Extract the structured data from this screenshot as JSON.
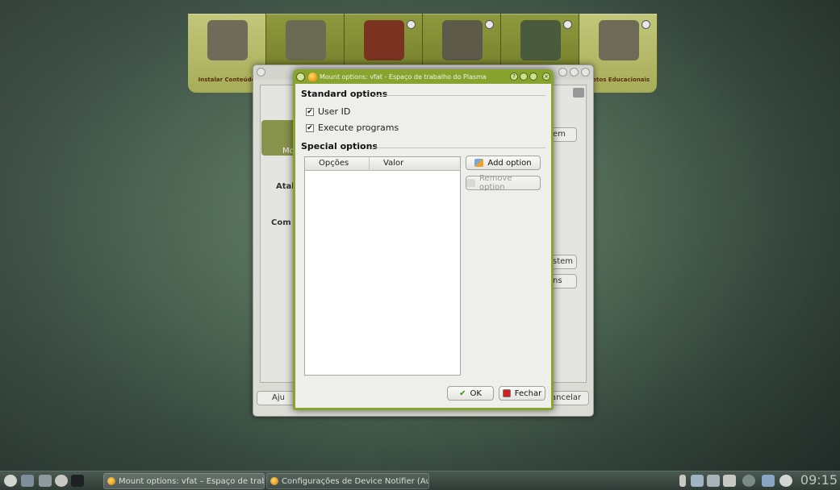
{
  "launcher": {
    "tiles": [
      {
        "label": "Instalar Conteúdo",
        "art_color": "#6f6b58"
      },
      {
        "label": "",
        "art_color": "#6b6a52"
      },
      {
        "label": "",
        "art_color": "#7a3320"
      },
      {
        "label": "",
        "art_color": "#5d5a4a"
      },
      {
        "label": "",
        "art_color": "#4a5a3c"
      },
      {
        "label": "bjetos Educacionais",
        "art_color": "#6d6a58"
      }
    ]
  },
  "background_window": {
    "tab_label": "Mo",
    "label_atal": "Atal",
    "label_comp": "Com",
    "btn_top": "em",
    "btn_mid1": "stem",
    "btn_mid2": "ns",
    "btn_help": "Aju",
    "btn_cancel": "ancelar"
  },
  "dialog": {
    "title": "Mount options: vfat - Espaço de trabalho do Plasma",
    "standard_group": "Standard options",
    "special_group": "Special options",
    "options": [
      {
        "label": "User ID",
        "checked": true
      },
      {
        "label": "Execute programs",
        "checked": true
      }
    ],
    "table": {
      "col1": "Opções",
      "col2": "Valor"
    },
    "add_option": "Add option",
    "remove_option": "Remove option",
    "ok": "OK",
    "close": "Fechar"
  },
  "taskbar": {
    "tasks": [
      {
        "label": "Mount options: vfat – Espaço de traba"
      },
      {
        "label": "Configurações de Device Notifier (Au"
      }
    ],
    "clock": "09:15"
  },
  "colors": {
    "dialog_frame": "#88a42f",
    "launcher_tile": "#8f9a3e",
    "check_mark": "#111111"
  }
}
